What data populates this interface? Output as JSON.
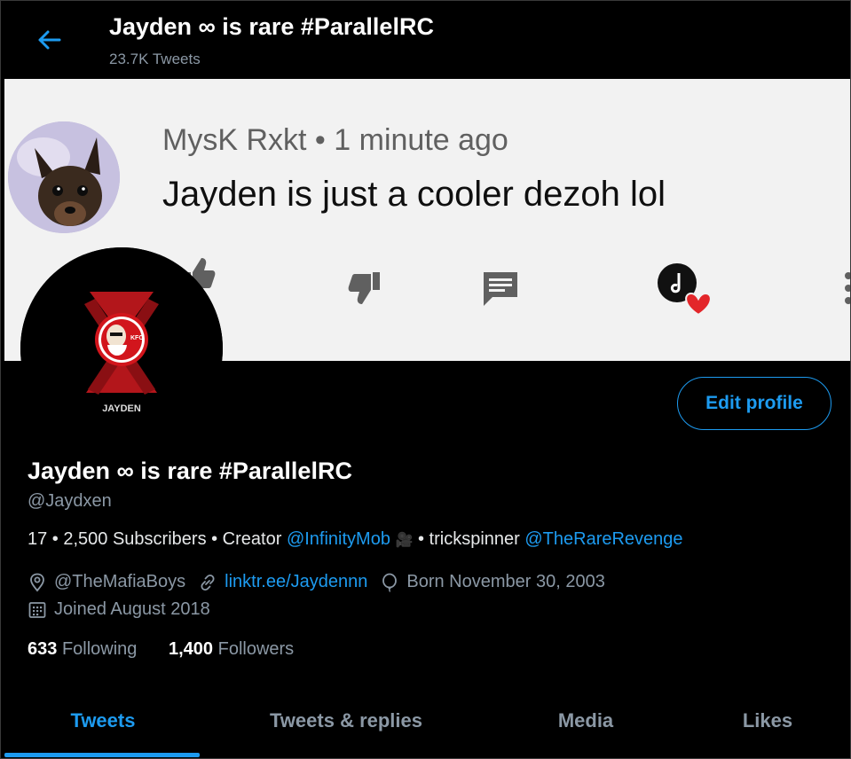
{
  "header": {
    "title": "Jayden ∞ is rare #ParallelRC",
    "tweet_count": "23.7K Tweets"
  },
  "banner": {
    "comment_author": "MysK Rxkt",
    "comment_separator": "•",
    "comment_time": "1 minute ago",
    "comment_text": "Jayden is just a cooler dezoh lol"
  },
  "avatar": {
    "caption": "JAYDEN",
    "badge_text": "KFC"
  },
  "actions": {
    "edit_profile": "Edit profile"
  },
  "profile": {
    "name": "Jayden ∞ is rare #ParallelRC",
    "handle": "@Jaydxen",
    "bio": {
      "part1": "17 • 2,500 Subscribers • Creator ",
      "mention1": "@InfinityMob",
      "emoji": "🎥",
      "part2": " • trickspinner ",
      "mention2": "@TheRareRevenge"
    },
    "location": "@TheMafiaBoys",
    "website": "linktr.ee/Jaydennn",
    "birthday": "Born November 30, 2003",
    "joined": "Joined August 2018",
    "following_count": "633",
    "following_label": "Following",
    "followers_count": "1,400",
    "followers_label": "Followers"
  },
  "tabs": [
    {
      "label": "Tweets",
      "active": true
    },
    {
      "label": "Tweets & replies",
      "active": false
    },
    {
      "label": "Media",
      "active": false
    },
    {
      "label": "Likes",
      "active": false
    }
  ],
  "colors": {
    "accent": "#1d9bf0",
    "background": "#000000",
    "muted": "#8b98a5",
    "banner_bg": "#f2f2f2"
  }
}
